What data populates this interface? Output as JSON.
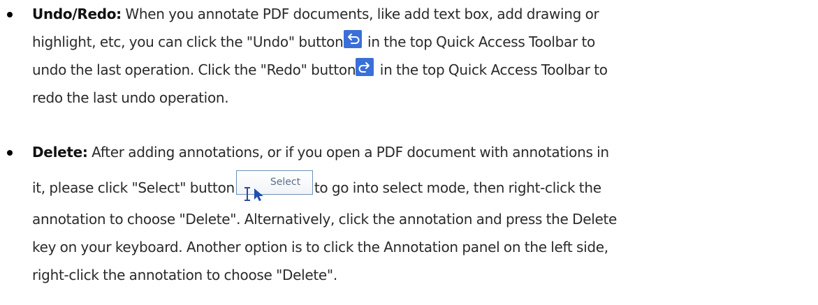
{
  "items": [
    {
      "term": "Undo/Redo:",
      "lines": [
        " When you annotate PDF documents, like add text box, add drawing or",
        "highlight, etc, you can click the \"Undo\" button",
        " in the top Quick Access Toolbar to",
        "undo the last operation. Click the \"Redo\" button",
        " in the top Quick Access Toolbar to",
        "redo the last undo operation."
      ],
      "icons": [
        "undo-icon",
        "redo-icon"
      ]
    },
    {
      "term": "Delete:",
      "lines": [
        " After adding annotations, or if you open a PDF document with annotations in",
        "it, please click \"Select\" button",
        "to go into select mode, then right-click the",
        "annotation to choose \"Delete\". Alternatively, click the annotation and press the Delete",
        "key on your keyboard. Another option is to click the Annotation panel on the left side,",
        "right-click the annotation to choose \"Delete\"."
      ],
      "select_button": {
        "label": "Select",
        "icon": "cursor-select-icon"
      }
    }
  ],
  "colors": {
    "text": "#2a2a2a",
    "icon_blue": "#3a6fd8",
    "select_border": "#6c8fb8"
  }
}
